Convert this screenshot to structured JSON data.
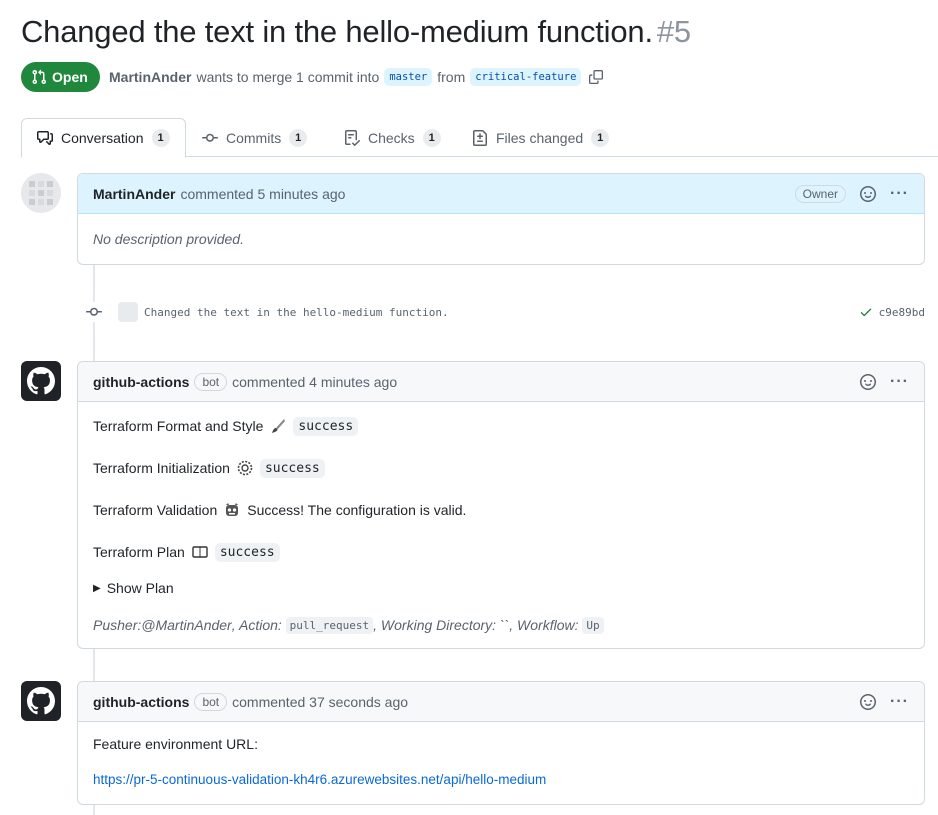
{
  "pr": {
    "title": "Changed the text in the hello-medium function.",
    "number": "#5",
    "state": "Open",
    "author": "MartinAnder",
    "merge_text": "wants to merge 1 commit into",
    "base_branch": "master",
    "from_text": "from",
    "head_branch": "critical-feature"
  },
  "tabs": [
    {
      "label": "Conversation",
      "count": "1",
      "icon": "comment-discussion-icon"
    },
    {
      "label": "Commits",
      "count": "1",
      "icon": "git-commit-icon"
    },
    {
      "label": "Checks",
      "count": "1",
      "icon": "checklist-icon"
    },
    {
      "label": "Files changed",
      "count": "1",
      "icon": "file-diff-icon"
    }
  ],
  "first_comment": {
    "author": "MartinAnder",
    "meta": "commented 5 minutes ago",
    "badge": "Owner",
    "body": "No description provided."
  },
  "commit": {
    "message": "Changed the text in the hello-medium function.",
    "sha": "c9e89bd",
    "status_color": "#1a7f37"
  },
  "bot_comment_1": {
    "author": "github-actions",
    "badge": "bot",
    "meta": "commented 4 minutes ago",
    "fmt_label": "Terraform Format and Style",
    "fmt_status": "success",
    "init_label": "Terraform Initialization",
    "init_status": "success",
    "val_label": "Terraform Validation",
    "val_status": "Success! The configuration is valid.",
    "plan_label": "Terraform Plan",
    "plan_status": "success",
    "show_plan": "Show Plan",
    "pusher_prefix": "Pusher: ",
    "pusher_user": "@MartinAnder",
    "action_prefix": ", Action: ",
    "action_value": "pull_request",
    "workdir_text": ", Working Directory: ``, Workflow: ",
    "workflow_value": "Up"
  },
  "bot_comment_2": {
    "author": "github-actions",
    "badge": "bot",
    "meta": "commented 37 seconds ago",
    "label": "Feature environment URL:",
    "url": "https://pr-5-continuous-validation-kh4r6.azurewebsites.net/api/hello-medium"
  },
  "colors": {
    "open_green": "#1f883d",
    "link_blue": "#0969da",
    "owner_header": "#ddf4ff"
  }
}
